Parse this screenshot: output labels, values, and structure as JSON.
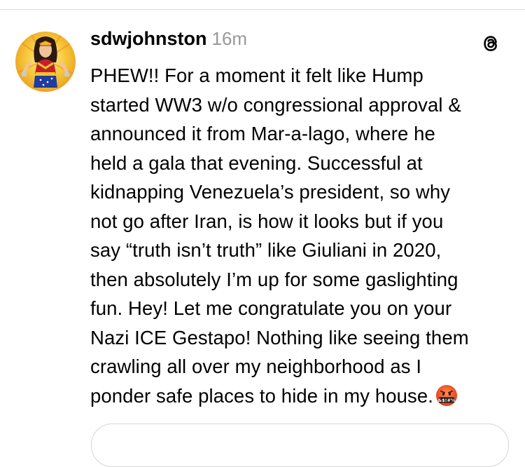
{
  "post": {
    "username": "sdwjohnston",
    "timestamp": "16m",
    "body": "PHEW!! For a moment it felt like Hump\nstarted WW3 w/o congressional approval &\nannounced it from Mar-a-lago, where he\nheld a gala that evening. Successful at\nkidnapping Venezuela’s president, so why\nnot go after Iran, is how it looks but if you\nsay “truth isn’t truth” like Giuliani in 2020,\nthen absolutely I’m up for some gaslighting\nfun. Hey! Let me congratulate you on your\nNazi ICE Gestapo! Nothing like seeing them\ncrawling all over my neighborhood as I\nponder safe places to hide in my house.",
    "emoji_label": "&$!#%",
    "emoji_icon": "cursing-face-emoji",
    "avatar_icon": "wonder-woman-avatar",
    "platform_icon": "threads-logo-icon"
  },
  "colors": {
    "text": "#000000",
    "timestamp": "#999999",
    "divider": "#d9d9d9",
    "avatar_bg": "#f2c230",
    "emoji_face": "#e8452c"
  }
}
